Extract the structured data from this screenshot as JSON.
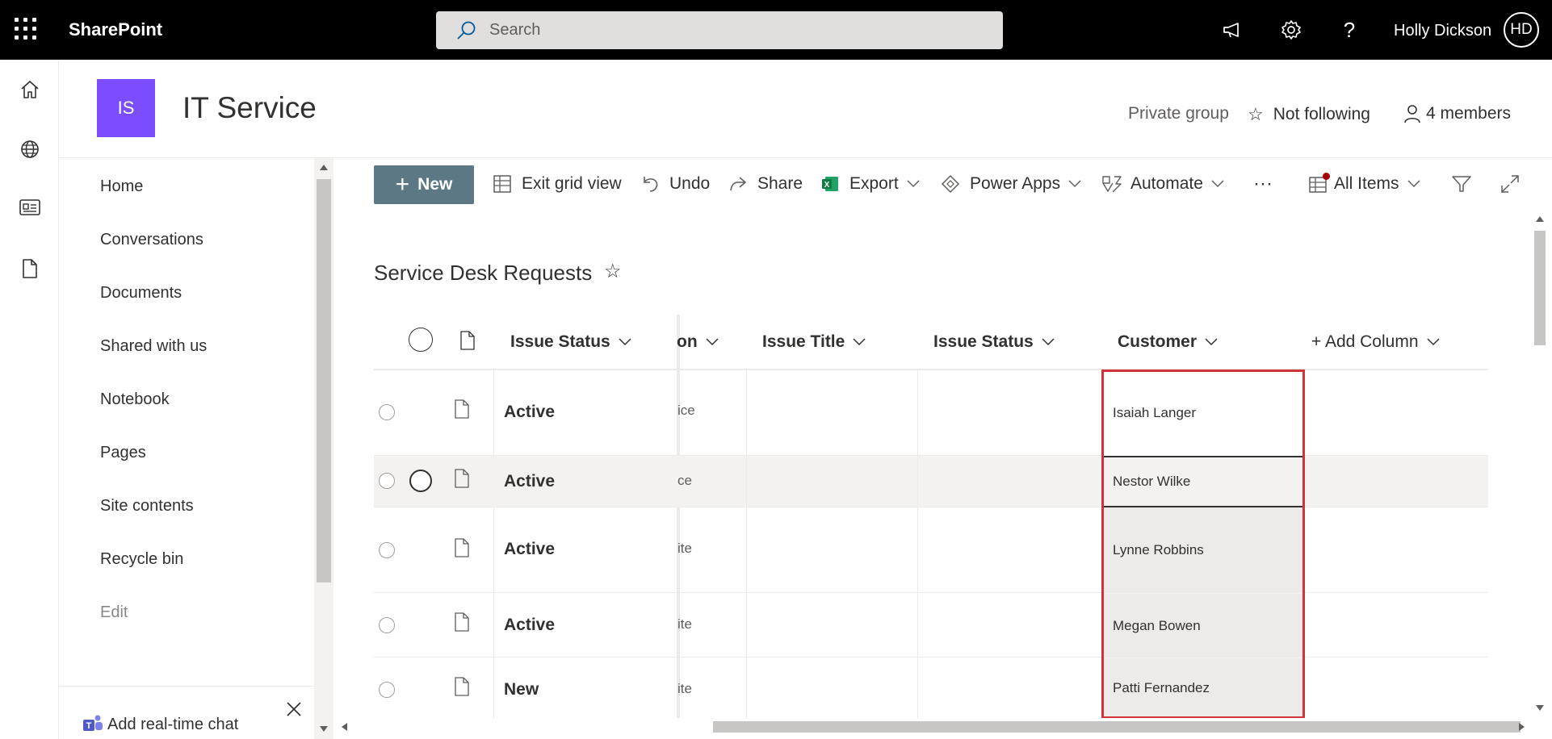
{
  "suite_bar": {
    "app_name": "SharePoint",
    "search_placeholder": "Search",
    "user_name": "Holly Dickson",
    "user_initials": "HD",
    "icons": [
      "app-launcher-icon",
      "search-icon",
      "megaphone-icon",
      "gear-icon",
      "help-icon"
    ]
  },
  "app_bar": {
    "icons": [
      "home-icon",
      "globe-icon",
      "news-icon",
      "file-icon"
    ]
  },
  "site": {
    "logo_initials": "IS",
    "logo_color": "#7c4dff",
    "title": "IT Service",
    "privacy": "Private group",
    "follow_label": "Not following",
    "members_label": "4 members"
  },
  "left_nav": {
    "items": [
      "Home",
      "Conversations",
      "Documents",
      "Shared with us",
      "Notebook",
      "Pages",
      "Site contents",
      "Recycle bin"
    ],
    "edit_label": "Edit",
    "chat_label": "Add real-time chat"
  },
  "command_bar": {
    "new_label": "New",
    "exit_grid_label": "Exit grid view",
    "undo_label": "Undo",
    "share_label": "Share",
    "export_label": "Export",
    "power_apps_label": "Power Apps",
    "automate_label": "Automate",
    "more_label": "···",
    "view_label": "All Items"
  },
  "list": {
    "title": "Service Desk Requests",
    "columns": {
      "status": "Issue Status",
      "truncated": "on",
      "issue_title": "Issue Title",
      "issue_status": "Issue Status",
      "customer": "Customer",
      "add_column": "+ Add Column"
    },
    "rows": [
      {
        "status": "Active",
        "truncated": "ice",
        "customer": "Isaiah Langer"
      },
      {
        "status": "Active",
        "truncated": "ce",
        "customer": "Nestor Wilke"
      },
      {
        "status": "Active",
        "truncated": "ite",
        "customer": "Lynne Robbins"
      },
      {
        "status": "Active",
        "truncated": "ite",
        "customer": "Megan Bowen"
      },
      {
        "status": "New",
        "truncated": "ite",
        "customer": "Patti Fernandez"
      }
    ]
  },
  "colors": {
    "suite_bar": "#000000",
    "new_button": "#5c7885",
    "highlight_box": "#d13438",
    "excel_green": "#107c41"
  }
}
